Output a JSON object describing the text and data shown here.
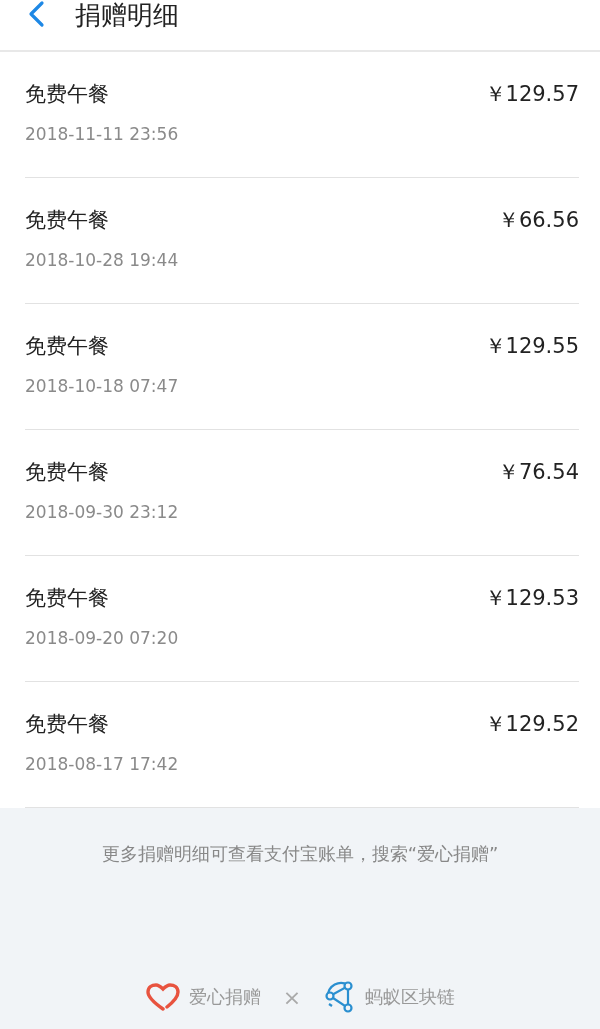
{
  "header": {
    "title": "捐赠明细"
  },
  "donations": [
    {
      "name": "免费午餐",
      "amount": "￥129.57",
      "time": "2018-11-11 23:56"
    },
    {
      "name": "免费午餐",
      "amount": "￥66.56",
      "time": "2018-10-28 19:44"
    },
    {
      "name": "免费午餐",
      "amount": "￥129.55",
      "time": "2018-10-18 07:47"
    },
    {
      "name": "免费午餐",
      "amount": "￥76.54",
      "time": "2018-09-30 23:12"
    },
    {
      "name": "免费午餐",
      "amount": "￥129.53",
      "time": "2018-09-20 07:20"
    },
    {
      "name": "免费午餐",
      "amount": "￥129.52",
      "time": "2018-08-17 17:42"
    }
  ],
  "footer": {
    "note": "更多捐赠明细可查看支付宝账单，搜索“爱心捐赠”",
    "brand_left": "爱心捐赠",
    "separator": "×",
    "brand_right": "蚂蚁区块链"
  }
}
